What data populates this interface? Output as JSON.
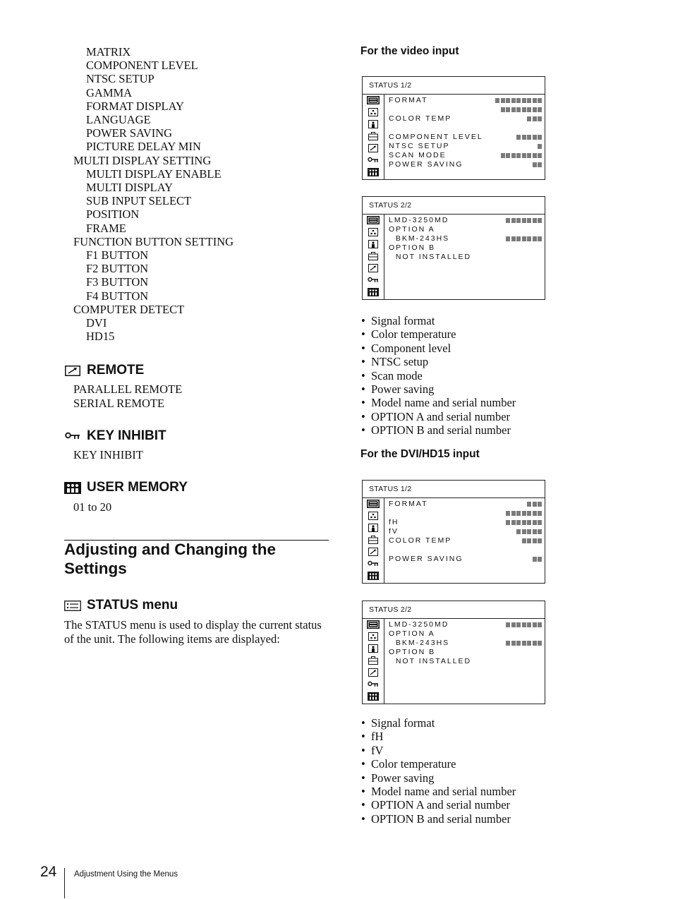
{
  "left_tree": [
    {
      "text": "MATRIX",
      "level": 2
    },
    {
      "text": "COMPONENT LEVEL",
      "level": 2
    },
    {
      "text": "NTSC SETUP",
      "level": 2
    },
    {
      "text": "GAMMA",
      "level": 2
    },
    {
      "text": "FORMAT DISPLAY",
      "level": 2
    },
    {
      "text": "LANGUAGE",
      "level": 2
    },
    {
      "text": "POWER SAVING",
      "level": 2
    },
    {
      "text": "PICTURE DELAY MIN",
      "level": 2
    },
    {
      "text": "MULTI DISPLAY SETTING",
      "level": 1
    },
    {
      "text": "MULTI DISPLAY ENABLE",
      "level": 2
    },
    {
      "text": "MULTI DISPLAY",
      "level": 2
    },
    {
      "text": "SUB INPUT SELECT",
      "level": 2
    },
    {
      "text": "POSITION",
      "level": 2
    },
    {
      "text": "FRAME",
      "level": 2
    },
    {
      "text": "FUNCTION BUTTON SETTING",
      "level": 1
    },
    {
      "text": "F1 BUTTON",
      "level": 2
    },
    {
      "text": "F2 BUTTON",
      "level": 2
    },
    {
      "text": "F3 BUTTON",
      "level": 2
    },
    {
      "text": "F4 BUTTON",
      "level": 2
    },
    {
      "text": "COMPUTER DETECT",
      "level": 1
    },
    {
      "text": "DVI",
      "level": 2
    },
    {
      "text": "HD15",
      "level": 2
    }
  ],
  "remote": {
    "icon": "remote-arrow-icon",
    "title": "REMOTE",
    "items": [
      "PARALLEL REMOTE",
      "SERIAL REMOTE"
    ]
  },
  "key_inhibit": {
    "icon": "key-icon",
    "title": "KEY INHIBIT",
    "items": [
      "KEY INHIBIT"
    ]
  },
  "user_memory": {
    "icon": "user-memory-icon",
    "title": "USER MEMORY",
    "items": [
      "01 to 20"
    ]
  },
  "section_title": "Adjusting and Changing the Settings",
  "status_menu": {
    "icon": "status-icon",
    "title": "STATUS menu",
    "body": "The STATUS menu is used to display the current status of the unit. The following items are displayed:"
  },
  "video_input": {
    "heading": "For the video input",
    "screens": [
      {
        "title": "STATUS 1/2",
        "rows": [
          {
            "label": "FORMAT",
            "blocks": 9
          },
          {
            "label": "",
            "blocks": 8
          },
          {
            "label": "COLOR TEMP",
            "blocks": 3
          },
          {
            "label": "",
            "blocks": 0
          },
          {
            "label": "COMPONENT LEVEL",
            "blocks": 5
          },
          {
            "label": "NTSC SETUP",
            "blocks": 1
          },
          {
            "label": "SCAN MODE",
            "blocks": 8
          },
          {
            "label": "POWER SAVING",
            "blocks": 2
          }
        ]
      },
      {
        "title": "STATUS 2/2",
        "rows": [
          {
            "label": "LMD-3250MD",
            "blocks": 7
          },
          {
            "label": "OPTION A",
            "blocks": 0
          },
          {
            "label": "  BKM-243HS",
            "blocks": 7
          },
          {
            "label": "OPTION B",
            "blocks": 0
          },
          {
            "label": "  NOT INSTALLED",
            "blocks": 0
          }
        ]
      }
    ],
    "bullets": [
      "Signal format",
      "Color temperature",
      "Component level",
      "NTSC setup",
      "Scan mode",
      "Power saving",
      "Model name and serial number",
      "OPTION A and serial number",
      "OPTION B and serial number"
    ]
  },
  "dvi_input": {
    "heading": "For the DVI/HD15 input",
    "screens": [
      {
        "title": "STATUS 1/2",
        "rows": [
          {
            "label": "FORMAT",
            "blocks": 3
          },
          {
            "label": "",
            "blocks": 7
          },
          {
            "label": "fH",
            "blocks": 7
          },
          {
            "label": "fV",
            "blocks": 5
          },
          {
            "label": "COLOR TEMP",
            "blocks": 4
          },
          {
            "label": "",
            "blocks": 0
          },
          {
            "label": "POWER SAVING",
            "blocks": 2
          }
        ]
      },
      {
        "title": "STATUS 2/2",
        "rows": [
          {
            "label": "LMD-3250MD",
            "blocks": 7
          },
          {
            "label": "OPTION A",
            "blocks": 0
          },
          {
            "label": "  BKM-243HS",
            "blocks": 7
          },
          {
            "label": "OPTION B",
            "blocks": 0
          },
          {
            "label": "  NOT INSTALLED",
            "blocks": 0
          }
        ]
      }
    ],
    "bullets": [
      "Signal format",
      "fH",
      "fV",
      "Color temperature",
      "Power saving",
      "Model name and serial number",
      "OPTION A and serial number",
      "OPTION B and serial number"
    ]
  },
  "osd_side_icons": [
    "status-icon",
    "color-icon",
    "user-control-icon",
    "toolbox-icon",
    "remote-arrow-icon",
    "key-icon",
    "user-memory-icon"
  ],
  "footer": {
    "page_number": "24",
    "section": "Adjustment Using the Menus"
  }
}
